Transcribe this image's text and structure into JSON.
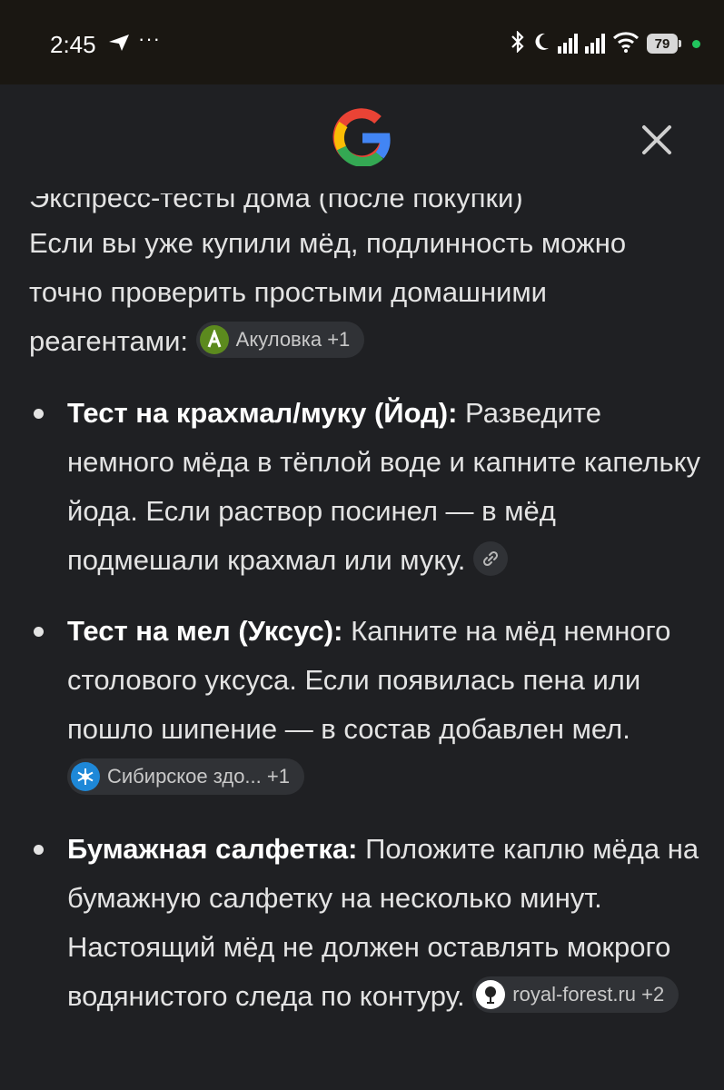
{
  "status": {
    "time": "2:45",
    "dots": "···",
    "battery": "79"
  },
  "header": {
    "logo": "google-g-icon",
    "close_icon": "close-icon"
  },
  "article": {
    "cut_heading": "Экспресс-тесты дома (после покупки)",
    "intro_text": "Если вы уже купили мёд, подлинность можно точно проверить простыми домашними реагентами:",
    "intro_source": "Акуловка +1",
    "items": [
      {
        "title": "Тест на крахмал/муку (Йод):",
        "text": " Разведите немного мёда в тёплой воде и капните капельку йода. Если раствор посинел — в мёд подмешали крахмал или муку.",
        "source": ""
      },
      {
        "title": "Тест на мел (Уксус):",
        "text": " Капните на мёд немного столового уксуса. Если появилась пена или пошло шипение — в состав добавлен мел.",
        "source": "Сибирское здо... +1"
      },
      {
        "title": "Бумажная салфетка:",
        "text": " Положите каплю мёда на бумажную салфетку на несколько минут. Настоящий мёд не должен оставлять мокрого водянистого следа по контуру.",
        "source": "royal-forest.ru +2"
      }
    ]
  },
  "colors": {
    "background": "#1f2023",
    "statusbar": "#1a1712",
    "text": "#e3e3e3",
    "chip": "#303236"
  }
}
